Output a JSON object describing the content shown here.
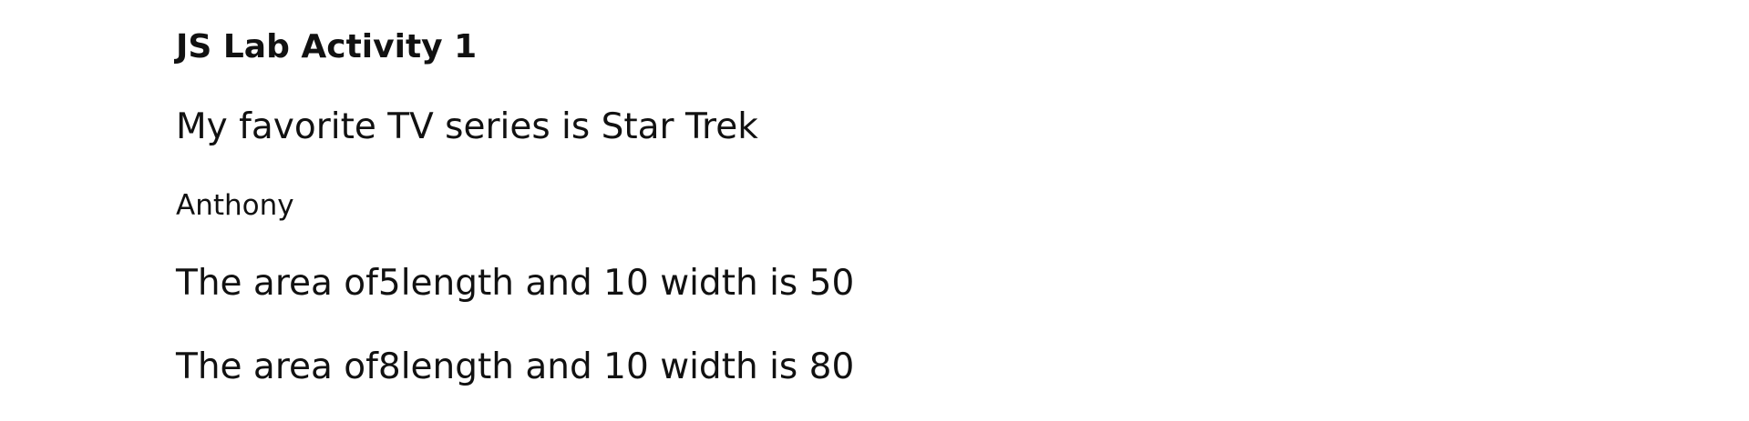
{
  "page": {
    "heading": "JS Lab Activity 1",
    "favorite_line": "My favorite TV series is Star Trek",
    "name_line": "Anthony",
    "area_lines": [
      "The area of5length and 10 width is 50",
      "The area of8length and 10 width is 80"
    ]
  }
}
